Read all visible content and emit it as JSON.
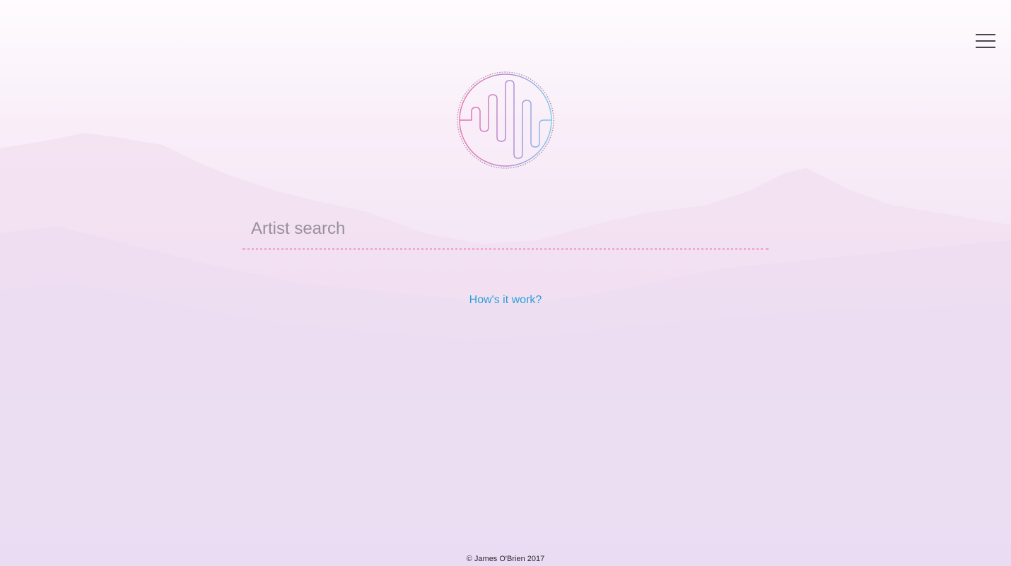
{
  "header": {
    "menu_icon": "hamburger-menu-icon"
  },
  "logo": {
    "icon": "sound-wave-circle-logo",
    "colors": {
      "pink": "#ec6fae",
      "blue": "#7fc6ea",
      "purple": "#b48fd6"
    }
  },
  "search": {
    "placeholder": "Artist search",
    "value": "",
    "underline_color": "#f3a8d2"
  },
  "help": {
    "link_label": "How's it work?",
    "link_color": "#2aa0d8"
  },
  "footer": {
    "copyright": "© James O'Brien 2017"
  }
}
